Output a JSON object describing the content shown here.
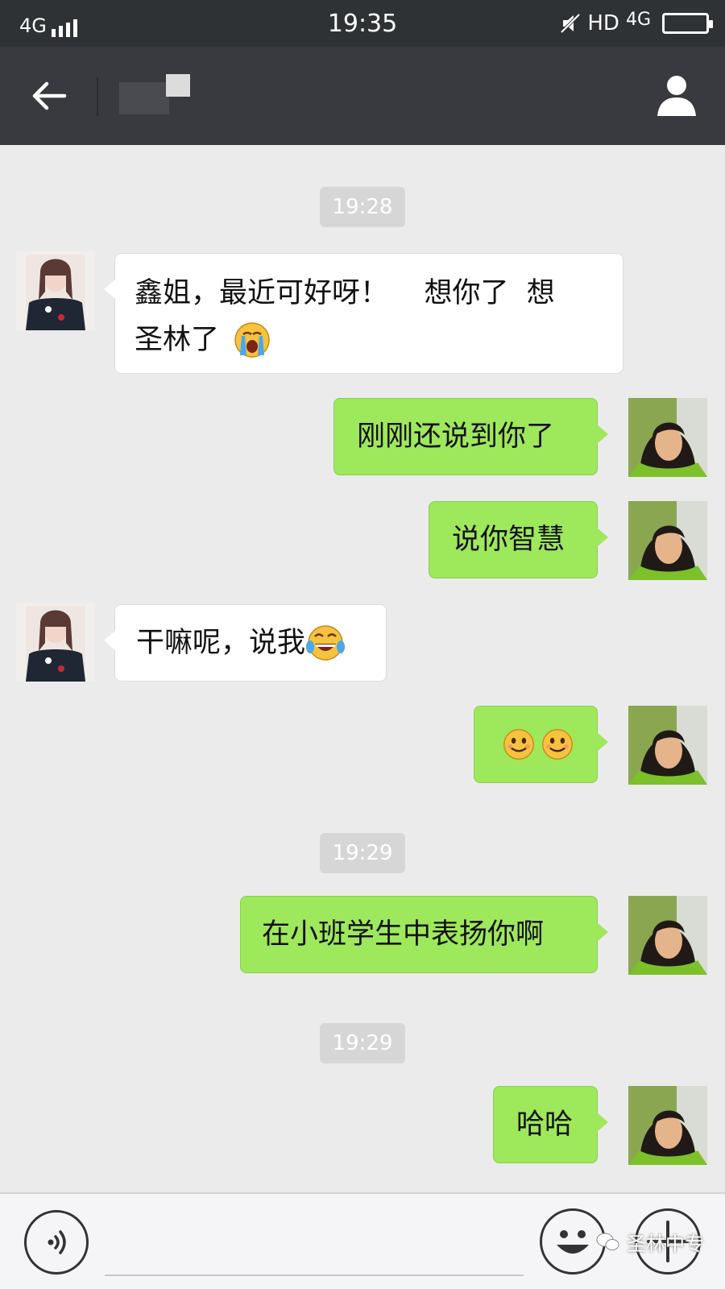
{
  "status_bar": {
    "network": "4G",
    "time": "19:35",
    "hd": "HD",
    "network_right": "4G"
  },
  "nav": {
    "contact_name": ""
  },
  "messages": [
    {
      "type": "time",
      "text": "19:28"
    },
    {
      "type": "in",
      "text": "鑫姐，最近可好呀！    想你了  想",
      "text2": "圣林了",
      "emoji": "crying-face"
    },
    {
      "type": "out",
      "text": "刚刚还说到你了"
    },
    {
      "type": "out",
      "text": "说你智慧"
    },
    {
      "type": "in",
      "text": "干嘛呢，说我",
      "emoji": "tears-of-joy-face"
    },
    {
      "type": "out",
      "text": "",
      "emoji": "smiling-face ×2"
    },
    {
      "type": "time",
      "text": "19:29"
    },
    {
      "type": "out",
      "text": "在小班学生中表扬你啊"
    },
    {
      "type": "time",
      "text": "19:29"
    },
    {
      "type": "out",
      "text": "哈哈"
    }
  ],
  "bottom_bar": {
    "watermark": "圣林中专"
  },
  "colors": {
    "status_bg": "#2f3234",
    "nav_bg": "#393a3f",
    "chat_bg": "#ebebeb",
    "out_bubble": "#9ee85b",
    "in_bubble": "#ffffff"
  }
}
